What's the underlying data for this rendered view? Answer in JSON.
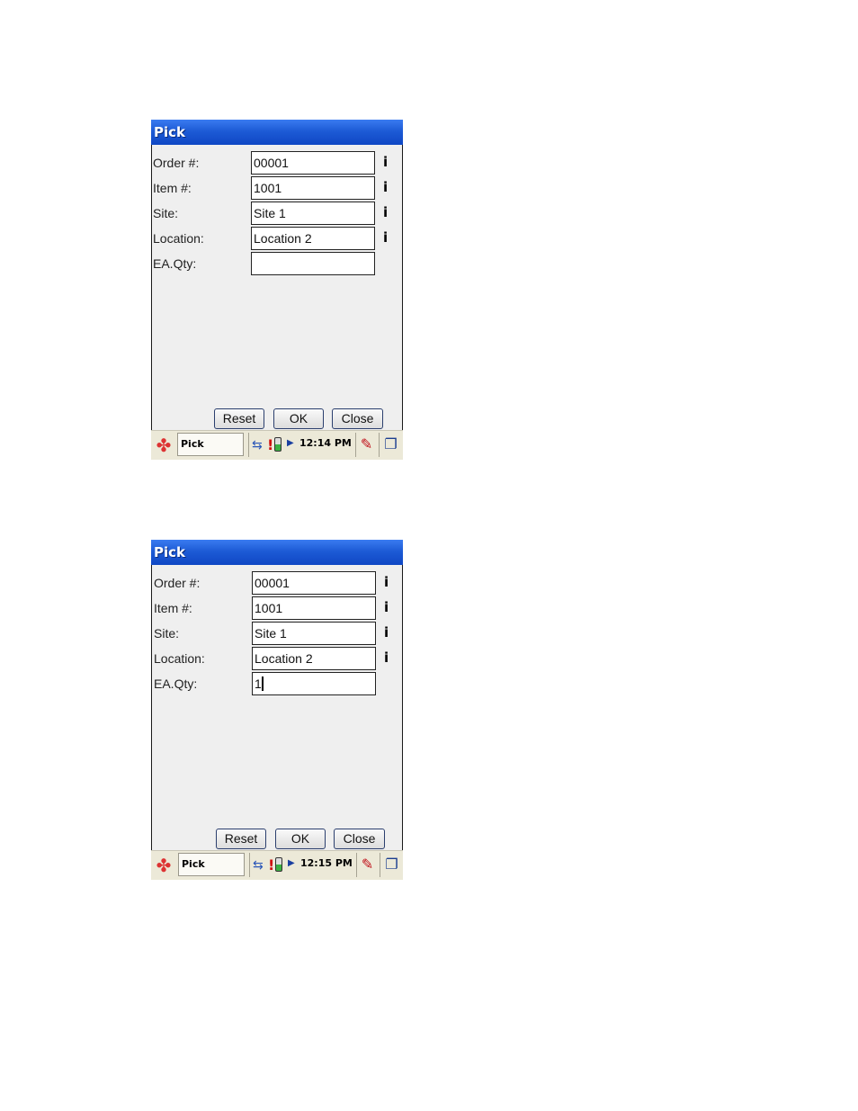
{
  "screens": [
    {
      "title": "Pick",
      "fields": [
        {
          "label": "Order #:",
          "value": "00001",
          "info": "i"
        },
        {
          "label": "Item #:",
          "value": "1001",
          "info": "i"
        },
        {
          "label": "Site:",
          "value": "Site 1",
          "info": "i"
        },
        {
          "label": "Location:",
          "value": "Location 2",
          "info": "i"
        },
        {
          "label": "EA.Qty:",
          "value": ""
        }
      ],
      "buttons": {
        "reset": "Reset",
        "ok": "OK",
        "close": "Close"
      },
      "taskbar": {
        "task": "Pick",
        "clock": "12:14 PM"
      }
    },
    {
      "title": "Pick",
      "fields": [
        {
          "label": "Order #:",
          "value": "00001",
          "info": "i"
        },
        {
          "label": "Item #:",
          "value": "1001",
          "info": "i"
        },
        {
          "label": "Site:",
          "value": "Site 1",
          "info": "i"
        },
        {
          "label": "Location:",
          "value": "Location 2",
          "info": "i"
        },
        {
          "label": "EA.Qty:",
          "value": "1"
        }
      ],
      "buttons": {
        "reset": "Reset",
        "ok": "OK",
        "close": "Close"
      },
      "taskbar": {
        "task": "Pick",
        "clock": "12:15 PM"
      }
    }
  ],
  "icons": {
    "start": "windows-start-icon",
    "network": "network-icon",
    "warning": "warning-icon",
    "battery": "battery-icon",
    "keyboard": "keyboard-icon",
    "windows": "window-switch-icon"
  }
}
